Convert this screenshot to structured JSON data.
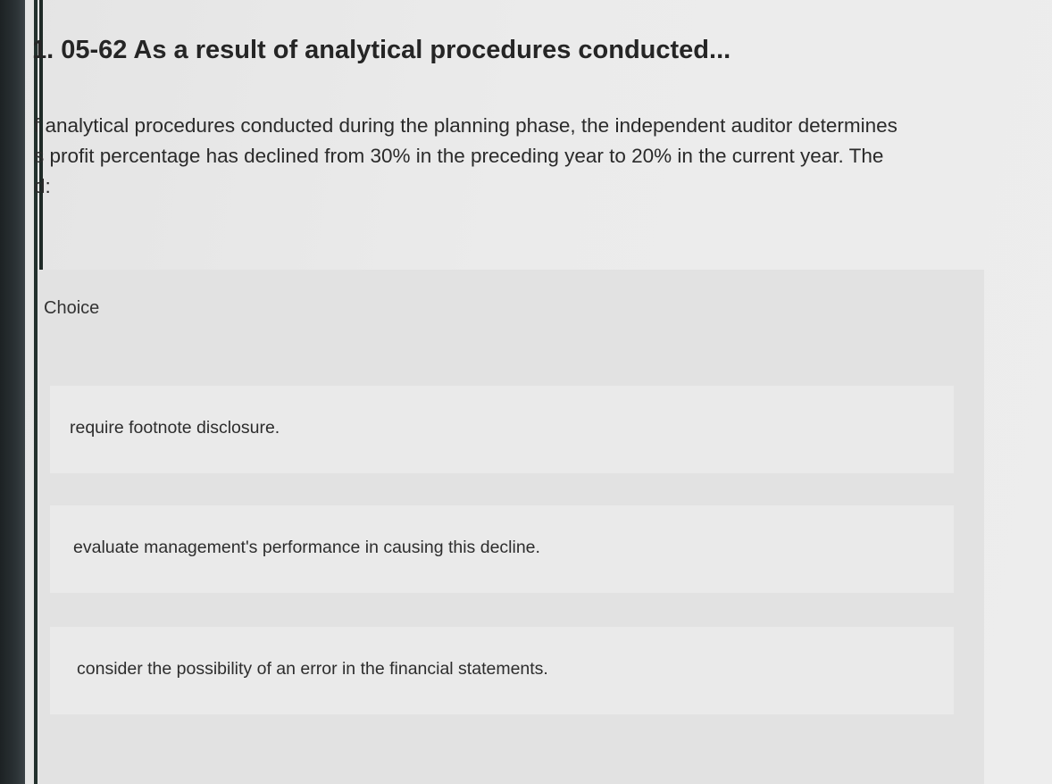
{
  "question": {
    "title": "1. 05-62 As a result of analytical procedures conducted...",
    "text_lines": [
      "f analytical procedures conducted during the planning phase, the independent auditor determines",
      "s profit percentage has declined from 30% in the preceding year to 20% in the current year. The",
      "d:"
    ]
  },
  "choices": {
    "header": "Choice",
    "options": [
      "require footnote disclosure.",
      "evaluate management's performance in causing this decline.",
      "consider the possibility of an error in the financial statements."
    ]
  }
}
